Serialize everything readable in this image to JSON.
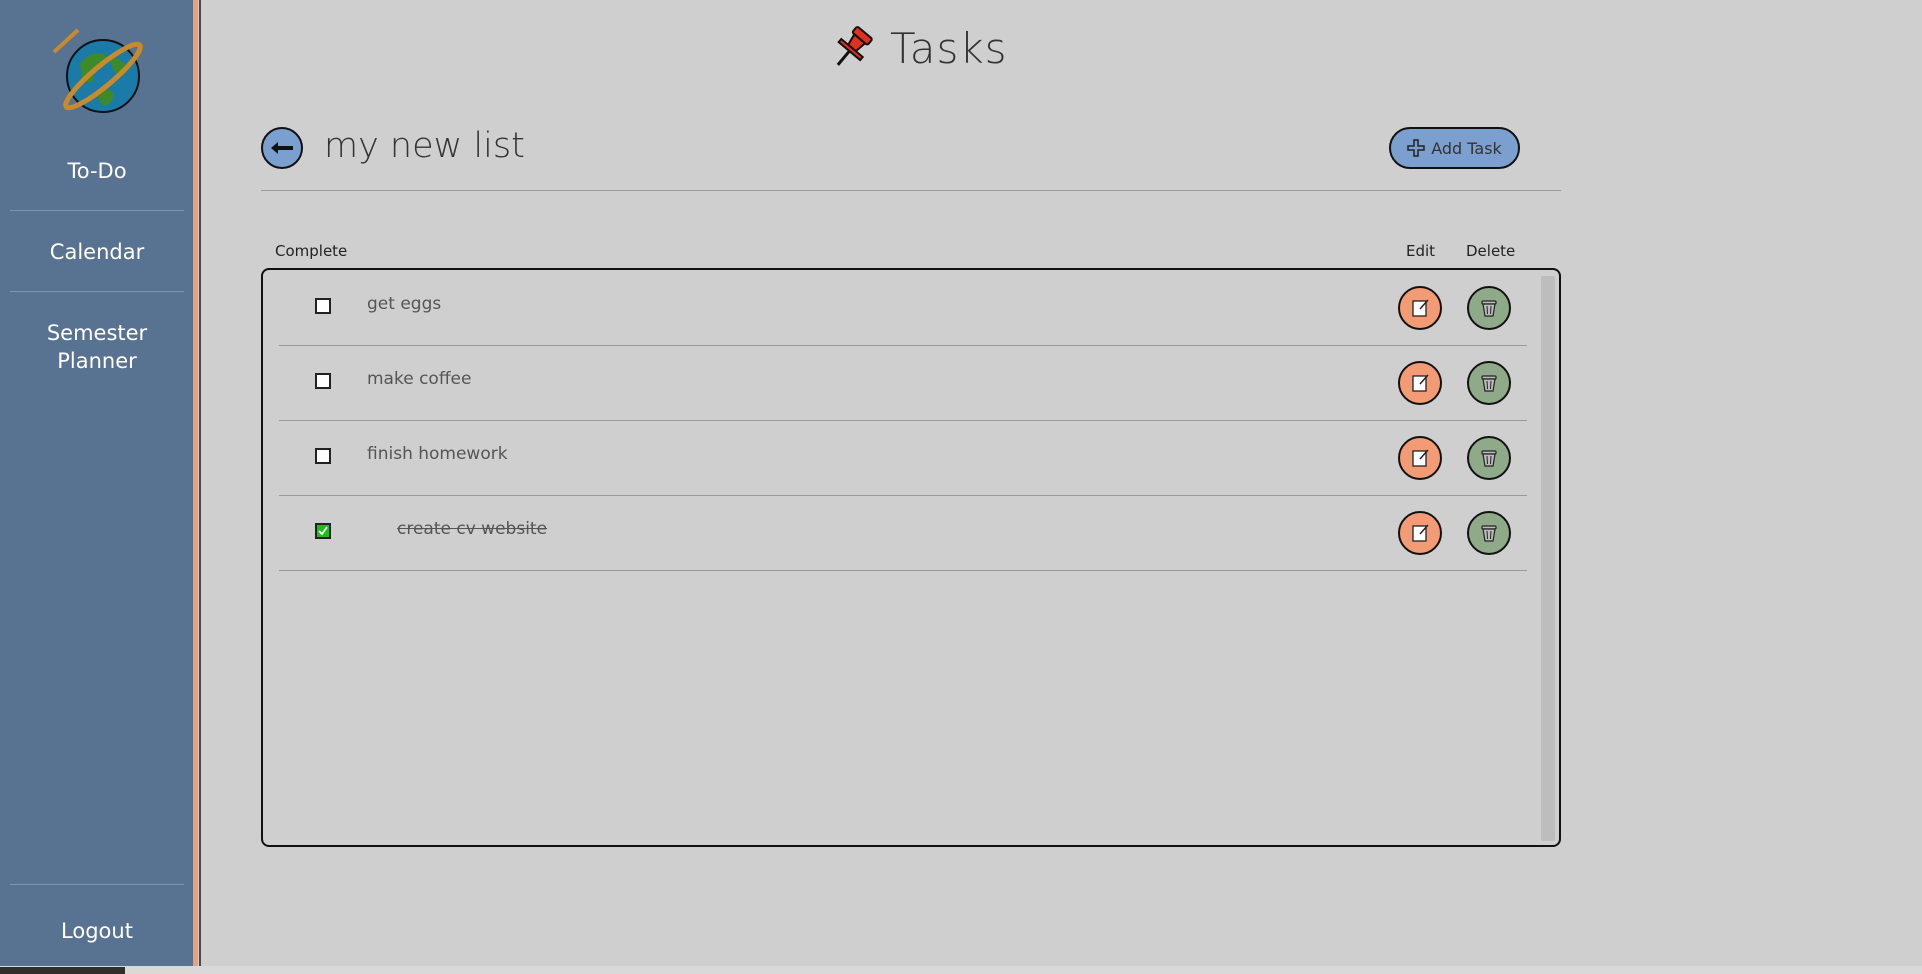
{
  "sidebar": {
    "nav": [
      {
        "label": "To-Do"
      },
      {
        "label": "Calendar"
      },
      {
        "label": "Semester Planner"
      }
    ],
    "logout_label": "Logout"
  },
  "header": {
    "title": "Tasks",
    "icon": "pushpin-icon"
  },
  "list": {
    "title": "my new list",
    "add_task_label": "Add Task",
    "columns": {
      "complete": "Complete",
      "edit": "Edit",
      "delete": "Delete"
    },
    "tasks": [
      {
        "text": "get eggs",
        "complete": false
      },
      {
        "text": "make coffee",
        "complete": false
      },
      {
        "text": "finish homework",
        "complete": false
      },
      {
        "text": "create cv website",
        "complete": true
      }
    ]
  },
  "colors": {
    "sidebar": "#587292",
    "accent": "#f0a077",
    "button_blue": "#7ba0cf",
    "edit_orange": "#f29b74",
    "delete_green": "#8faa88",
    "background": "#cfcfcf"
  }
}
